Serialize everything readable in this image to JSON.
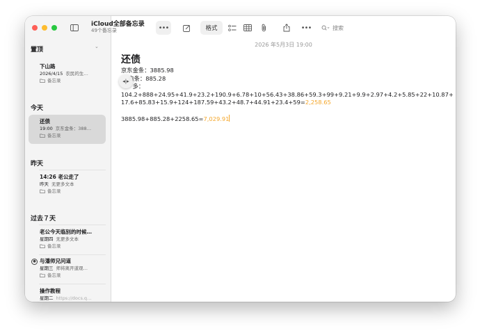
{
  "window": {
    "title": "iCloud全部备忘录",
    "subtitle": "49个备忘录"
  },
  "toolbar": {
    "format_label": "格式",
    "search_placeholder": "搜索"
  },
  "sidebar": {
    "sections": [
      {
        "header": "置顶",
        "notes": [
          {
            "title": "下山路",
            "date": "2026/4/15",
            "preview": "农民的生…",
            "folder": "备忘录"
          }
        ]
      },
      {
        "header": "今天",
        "notes": [
          {
            "title": "还债",
            "date": "19:00",
            "preview": "京东金条：388…",
            "folder": "备忘录"
          }
        ]
      },
      {
        "header": "昨天",
        "notes": [
          {
            "title": "14:26 老公走了",
            "date": "昨天",
            "preview": "无更多文本",
            "folder": "备忘录"
          }
        ]
      },
      {
        "header": "过去７天",
        "notes": [
          {
            "title": "老公今天临别的时候…",
            "date": "星期四",
            "preview": "无更多文本",
            "folder": "备忘录"
          },
          {
            "title": "与潘师兄问道",
            "date": "星期三",
            "preview": "师将离开道观…",
            "folder": "备忘录"
          },
          {
            "title": "操作教程",
            "date": "星期二",
            "preview": "https://docs.q…",
            "folder": ""
          }
        ]
      }
    ]
  },
  "editor": {
    "timestamp": "2026 年5月3日 19:00",
    "title": "还债",
    "line1": "京东金条：3885.98",
    "line2_prefix": "借",
    "line2_hidden": "",
    "line2_suffix": "白条：885.28",
    "line3": "花呗",
    "line3_suffix": "多：",
    "formula1": "104.2+888+24.95+41.9+23.2+190.9+6.78+10+56.43+38.86+59.3+99+9.21+9.9+2.97+4.2+5.85+22+10.87+17.6+85.83+15.9+124+187.59+43.2+48.7+44.91+23.4+59=",
    "result1": "2,258.65",
    "formula2": "3885.98+885.28+2258.65=",
    "result2": "7,029.91"
  },
  "colors": {
    "accent_result": "#f4a62a",
    "selected_row": "#d9d9d9",
    "close": "#fe5f57",
    "minimize": "#febc2e",
    "maximize": "#28c840"
  }
}
